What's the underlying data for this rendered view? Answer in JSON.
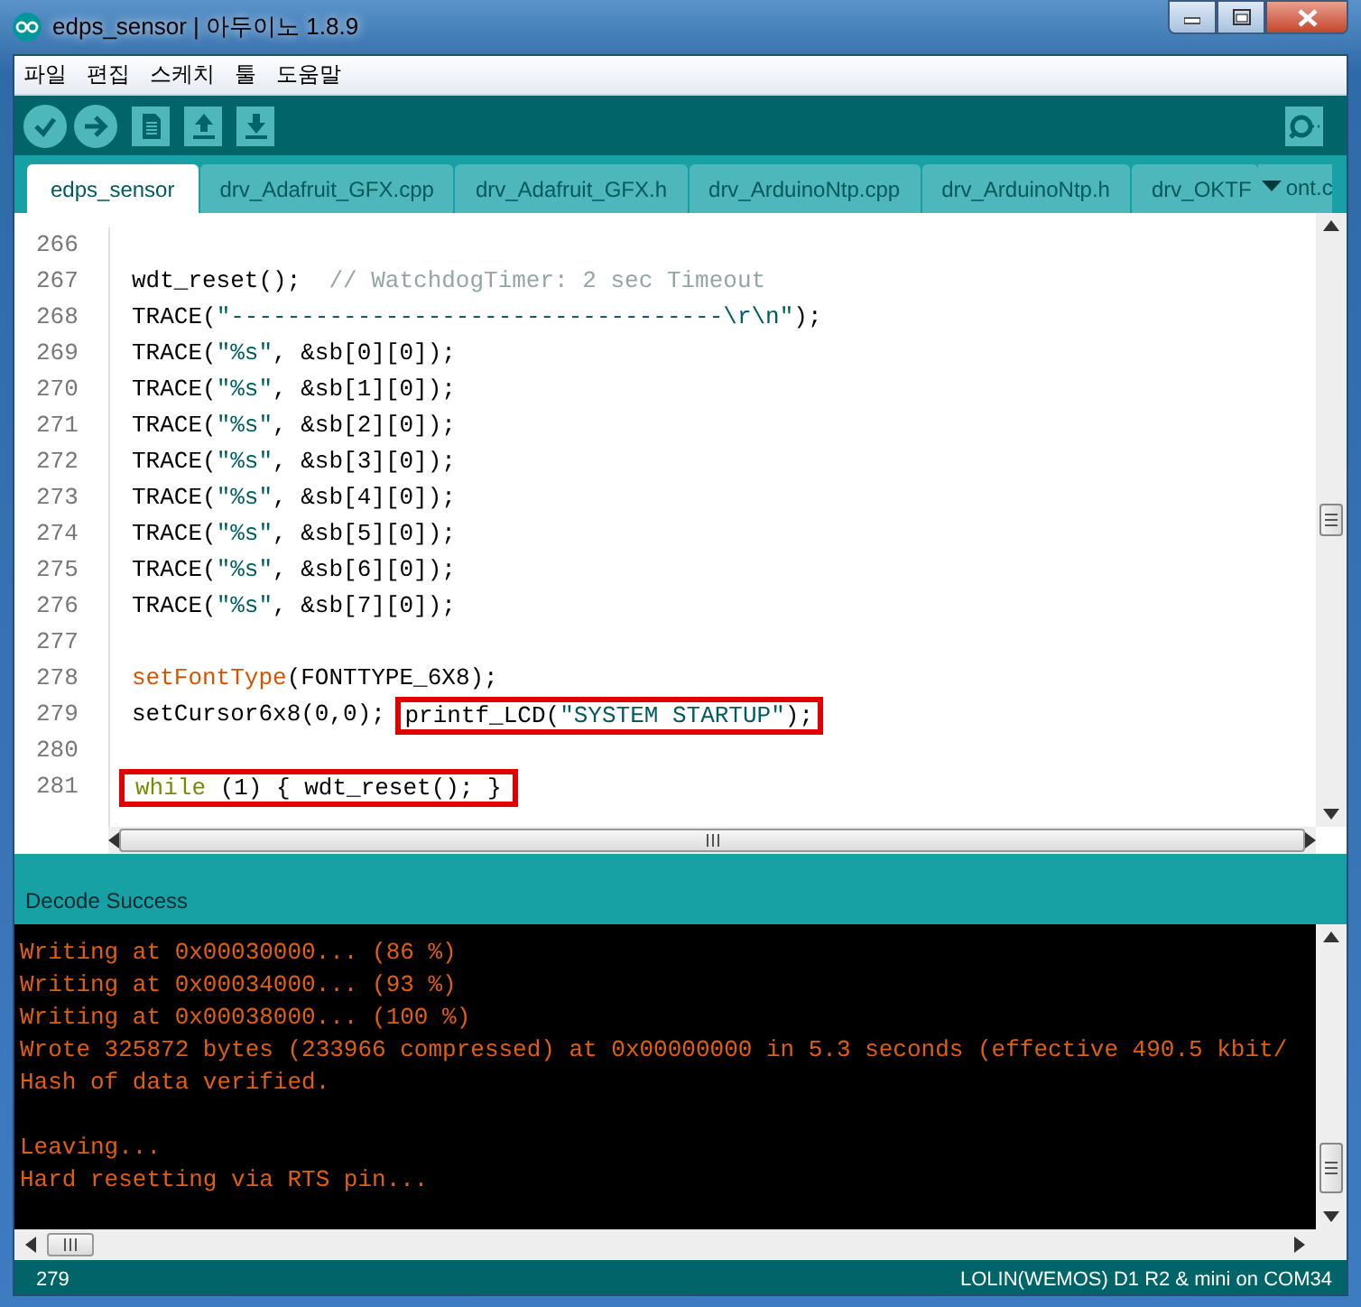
{
  "window": {
    "title": "edps_sensor | 아두이노 1.8.9"
  },
  "menu": [
    "파일",
    "편집",
    "스케치",
    "툴",
    "도움말"
  ],
  "toolbar": [
    {
      "kind": "verify"
    },
    {
      "kind": "upload"
    },
    {
      "kind": "new"
    },
    {
      "kind": "open"
    },
    {
      "kind": "save"
    },
    {
      "kind": "monitor"
    }
  ],
  "tabs": [
    {
      "label": "edps_sensor",
      "selected": true
    },
    {
      "label": "drv_Adafruit_GFX.cpp",
      "selected": false
    },
    {
      "label": "drv_Adafruit_GFX.h",
      "selected": false
    },
    {
      "label": "drv_ArduinoNtp.cpp",
      "selected": false
    },
    {
      "label": "drv_ArduinoNtp.h",
      "selected": false
    },
    {
      "label": "drv_OKTF",
      "selected": false
    }
  ],
  "tab_overflow_text": "ont.c",
  "editor": {
    "lines": [
      {
        "number": "266"
      },
      {
        "number": "267",
        "segments": [
          {
            "text": "wdt_reset();  ",
            "kind": "plain"
          },
          {
            "text": "// WatchdogTimer: 2 sec Timeout",
            "kind": "comment"
          }
        ]
      },
      {
        "number": "268",
        "segments": [
          {
            "text": "TRACE(",
            "kind": "plain"
          },
          {
            "text": "\"-----------------------------------\\r\\n\"",
            "kind": "string"
          },
          {
            "text": ");",
            "kind": "plain"
          }
        ]
      },
      {
        "number": "269",
        "segments": [
          {
            "text": "TRACE(",
            "kind": "plain"
          },
          {
            "text": "\"%s\"",
            "kind": "string"
          },
          {
            "text": ", &sb[0][0]);",
            "kind": "plain"
          }
        ]
      },
      {
        "number": "270",
        "segments": [
          {
            "text": "TRACE(",
            "kind": "plain"
          },
          {
            "text": "\"%s\"",
            "kind": "string"
          },
          {
            "text": ", &sb[1][0]);",
            "kind": "plain"
          }
        ]
      },
      {
        "number": "271",
        "segments": [
          {
            "text": "TRACE(",
            "kind": "plain"
          },
          {
            "text": "\"%s\"",
            "kind": "string"
          },
          {
            "text": ", &sb[2][0]);",
            "kind": "plain"
          }
        ]
      },
      {
        "number": "272",
        "segments": [
          {
            "text": "TRACE(",
            "kind": "plain"
          },
          {
            "text": "\"%s\"",
            "kind": "string"
          },
          {
            "text": ", &sb[3][0]);",
            "kind": "plain"
          }
        ]
      },
      {
        "number": "273",
        "segments": [
          {
            "text": "TRACE(",
            "kind": "plain"
          },
          {
            "text": "\"%s\"",
            "kind": "string"
          },
          {
            "text": ", &sb[4][0]);",
            "kind": "plain"
          }
        ]
      },
      {
        "number": "274",
        "segments": [
          {
            "text": "TRACE(",
            "kind": "plain"
          },
          {
            "text": "\"%s\"",
            "kind": "string"
          },
          {
            "text": ", &sb[5][0]);",
            "kind": "plain"
          }
        ]
      },
      {
        "number": "275",
        "segments": [
          {
            "text": "TRACE(",
            "kind": "plain"
          },
          {
            "text": "\"%s\"",
            "kind": "string"
          },
          {
            "text": ", &sb[6][0]);",
            "kind": "plain"
          }
        ]
      },
      {
        "number": "276",
        "segments": [
          {
            "text": "TRACE(",
            "kind": "plain"
          },
          {
            "text": "\"%s\"",
            "kind": "string"
          },
          {
            "text": ", &sb[7][0]);",
            "kind": "plain"
          }
        ]
      },
      {
        "number": "277"
      },
      {
        "number": "278",
        "segments": [
          {
            "text": "setFontType",
            "kind": "function"
          },
          {
            "text": "(FONTTYPE_6X8);",
            "kind": "plain"
          }
        ]
      },
      {
        "number": "279",
        "segments": [
          {
            "text": "setCursor6x8(0,0); ",
            "kind": "plain"
          },
          {
            "kind": "highlight",
            "parts": [
              {
                "text": "printf_LCD(",
                "kind": "plain"
              },
              {
                "text": "\"SYSTEM STARTUP\"",
                "kind": "string"
              },
              {
                "text": ");",
                "kind": "plain"
              }
            ]
          }
        ]
      },
      {
        "number": "280"
      },
      {
        "number": "281",
        "segments": [
          {
            "kind": "highlight",
            "parts": [
              {
                "text": "while",
                "kind": "keyword"
              },
              {
                "text": " (1) { wdt_reset(); }",
                "kind": "plain"
              }
            ]
          }
        ]
      }
    ]
  },
  "message_bar": "Decode Success",
  "console": {
    "lines": [
      {
        "kind": "text",
        "text": "Writing at 0x00030000... (86 %)"
      },
      {
        "kind": "text",
        "text": "Writing at 0x00034000... (93 %)"
      },
      {
        "kind": "text",
        "text": "Writing at 0x00038000... (100 %)"
      },
      {
        "kind": "text",
        "text": "Wrote 325872 bytes (233966 compressed) at 0x00000000 in 5.3 seconds (effective 490.5 kbit/"
      },
      {
        "kind": "text",
        "text": "Hash of data verified."
      },
      {
        "kind": "blank"
      },
      {
        "kind": "text",
        "text": "Leaving..."
      },
      {
        "kind": "text",
        "text": "Hard resetting via RTS pin..."
      }
    ]
  },
  "status_bar": {
    "line": "279",
    "board": "LOLIN(WEMOS) D1 R2 & mini on COM34"
  }
}
